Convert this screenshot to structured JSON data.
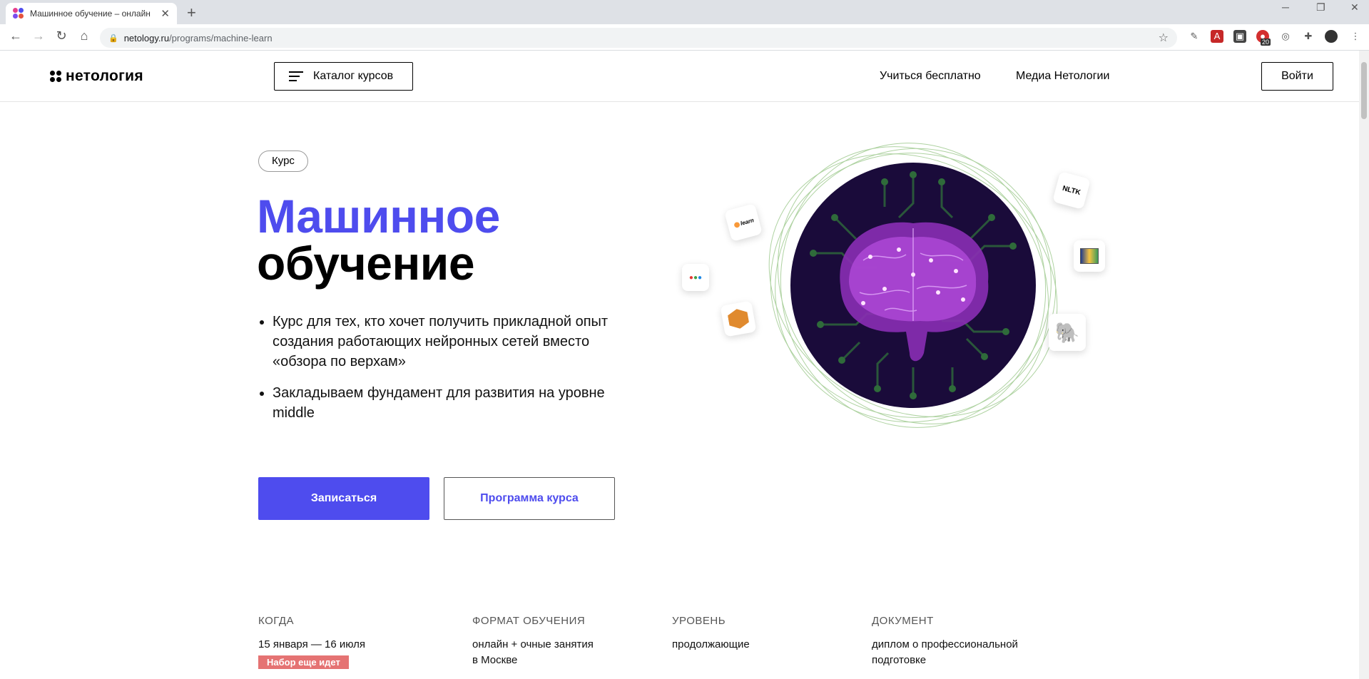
{
  "browser": {
    "tab_title": "Машинное обучение – онлайн",
    "url_host": "netology.ru",
    "url_path": "/programs/machine-learn",
    "extension_badge": "20"
  },
  "header": {
    "logo_text": "нетология",
    "catalog_label": "Каталог курсов",
    "nav": [
      "Учиться бесплатно",
      "Медиа Нетологии"
    ],
    "login_label": "Войти"
  },
  "hero": {
    "badge": "Курс",
    "title_line1": "Машинное",
    "title_line2": "обучение",
    "bullets": [
      "Курс для тех, кто хочет получить прикладной опыт создания работающих нейронных сетей вместо «обзора по верхам»",
      "Закладываем фундамент для развития на уровне middle"
    ],
    "primary_button": "Записаться",
    "secondary_button": "Программа курса"
  },
  "libraries": {
    "sklearn": "learn",
    "nltk": "NLTK"
  },
  "info": {
    "when_label": "КОГДА",
    "when_value": "15 января — 16 июля",
    "when_status": "Набор еще идет",
    "format_label": "ФОРМАТ ОБУЧЕНИЯ",
    "format_value_line1": "онлайн + очные занятия",
    "format_value_line2": "в Москве",
    "level_label": "УРОВЕНЬ",
    "level_value": "продолжающие",
    "doc_label": "ДОКУМЕНТ",
    "doc_value_line1": "диплом о профессиональной",
    "doc_value_line2": "подготовке"
  },
  "colors": {
    "accent": "#4e4cee",
    "status_tag": "#e57373",
    "circle_bg": "#1a0b3a"
  }
}
